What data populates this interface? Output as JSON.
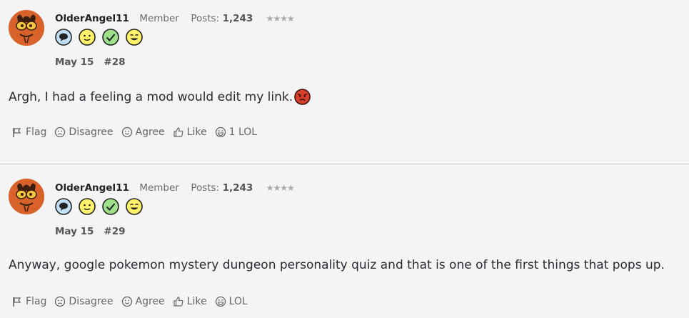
{
  "posts": [
    {
      "username": "OlderAngel11",
      "role": "Member",
      "posts_label": "Posts:",
      "posts_count": "1,243",
      "stars": "★★★★",
      "date": "May 15",
      "number": "#28",
      "body": "Argh, I had a feeling a mod would edit my link.",
      "actions": {
        "flag": "Flag",
        "disagree": "Disagree",
        "agree": "Agree",
        "like": "Like",
        "lol": "1 LOL"
      }
    },
    {
      "username": "OlderAngel11",
      "role": "Member",
      "posts_label": "Posts:",
      "posts_count": "1,243",
      "stars": "★★★★",
      "date": "May 15",
      "number": "#29",
      "body": "Anyway, google pokemon mystery dungeon personality quiz and that is one of the first things that pops up.",
      "actions": {
        "flag": "Flag",
        "disagree": "Disagree",
        "agree": "Agree",
        "like": "Like",
        "lol": "LOL"
      }
    }
  ],
  "badges": [
    "speech-bubble-badge-icon",
    "smile-badge-icon",
    "checkmark-badge-icon",
    "wink-badge-icon"
  ],
  "colors": {
    "avatar_bg": "#d9622b",
    "badge_blue": "#bfe0f5",
    "badge_yellow": "#fff26a",
    "badge_green": "#9fe08a",
    "angry_red": "#d8402a"
  }
}
